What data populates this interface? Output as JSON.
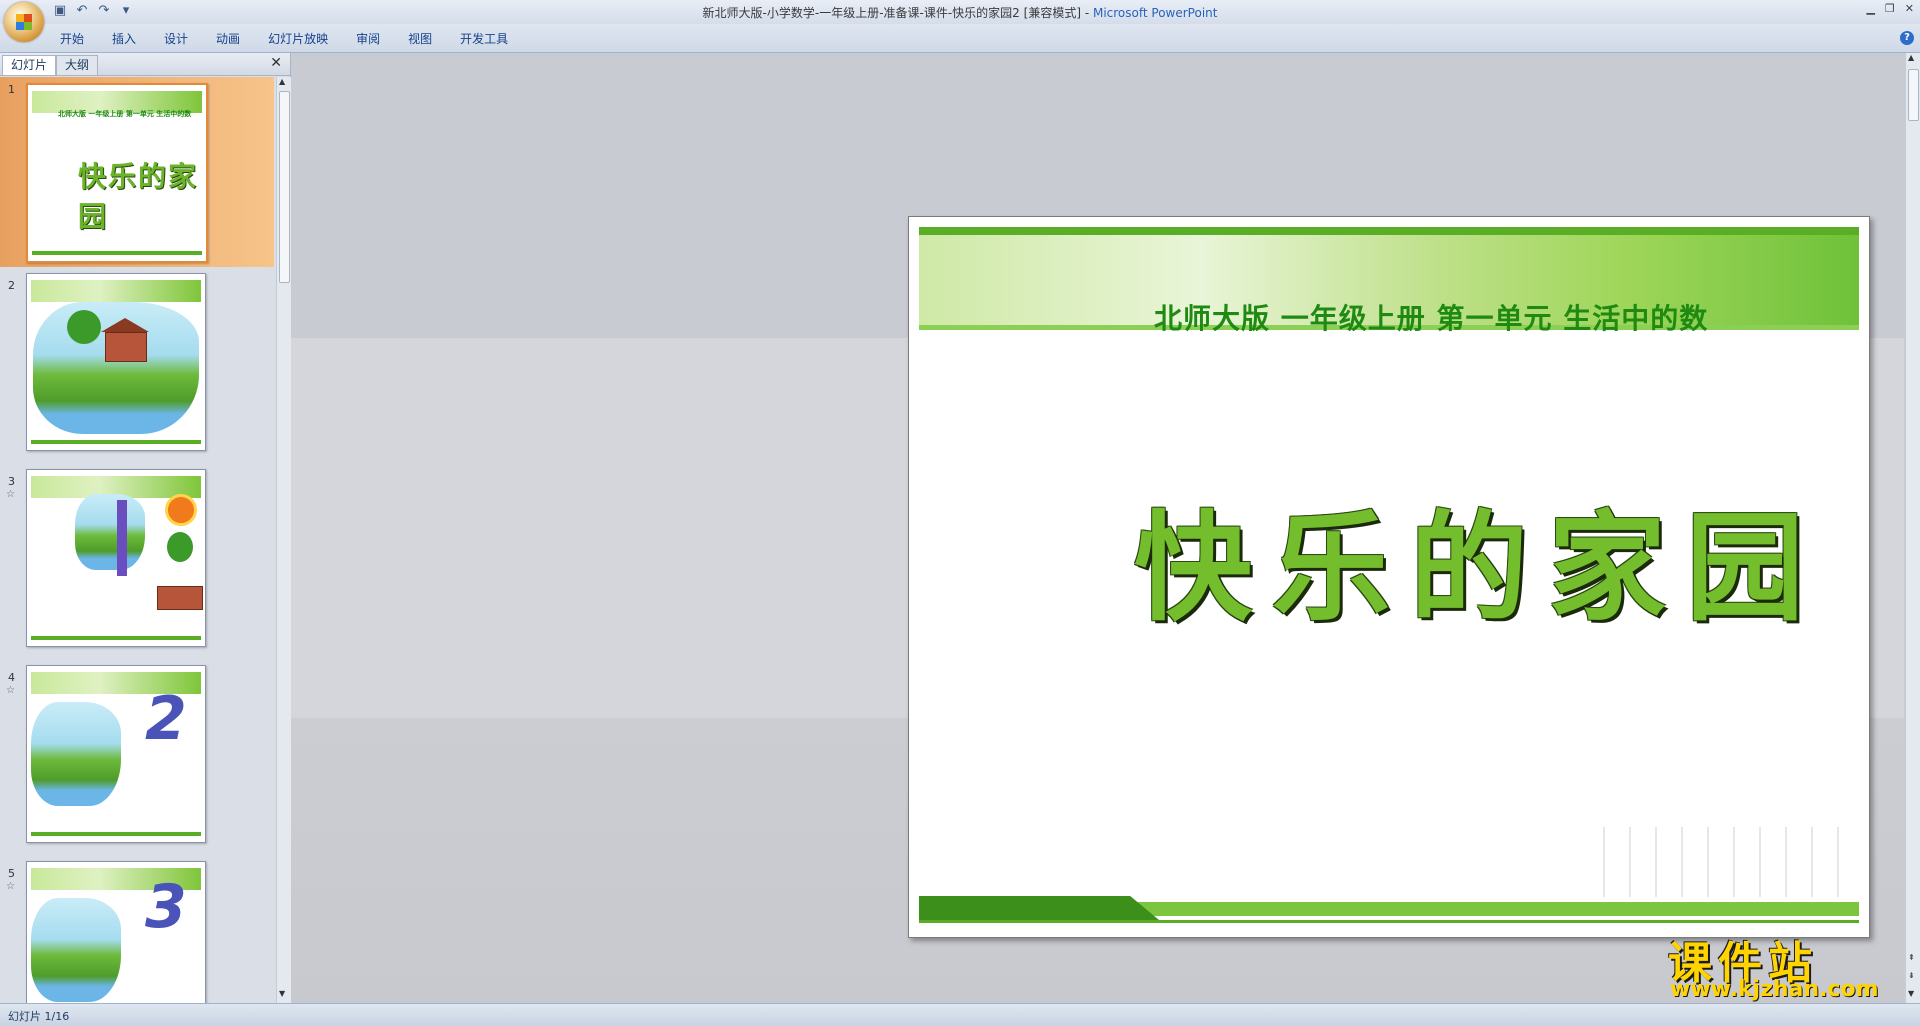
{
  "window": {
    "title": "新北师大版-小学数学-一年级上册-准备课-课件-快乐的家园2 [兼容模式]",
    "separator": " - ",
    "app_name": "Microsoft PowerPoint"
  },
  "quick_access": {
    "save_icon": "save-icon",
    "undo_icon": "undo-icon",
    "redo_icon": "redo-icon",
    "customize_icon": "dropdown-icon"
  },
  "ribbon": {
    "tabs": [
      "开始",
      "插入",
      "设计",
      "动画",
      "幻灯片放映",
      "审阅",
      "视图",
      "开发工具"
    ]
  },
  "left_pane": {
    "tabs": [
      "幻灯片",
      "大纲"
    ],
    "thumbnails": [
      {
        "num": "1",
        "subtitle": "北师大版  一年级上册  第一单元  生活中的数",
        "title": "快乐的家园",
        "selected": true
      },
      {
        "num": "2"
      },
      {
        "num": "3",
        "number_label": ""
      },
      {
        "num": "4",
        "number_label": "2"
      },
      {
        "num": "5",
        "number_label": "3"
      }
    ]
  },
  "slide": {
    "subtitle": "北师大版  一年级上册  第一单元  生活中的数",
    "title": "快乐的家园"
  },
  "status": {
    "slide_indicator": "幻灯片 1/16"
  },
  "watermark": {
    "cn": "课件站",
    "url": "www.kjzhan.com"
  },
  "colors": {
    "accent_green": "#74be2e",
    "dark_green": "#1e8a12",
    "selection_orange": "#e08a3a"
  }
}
